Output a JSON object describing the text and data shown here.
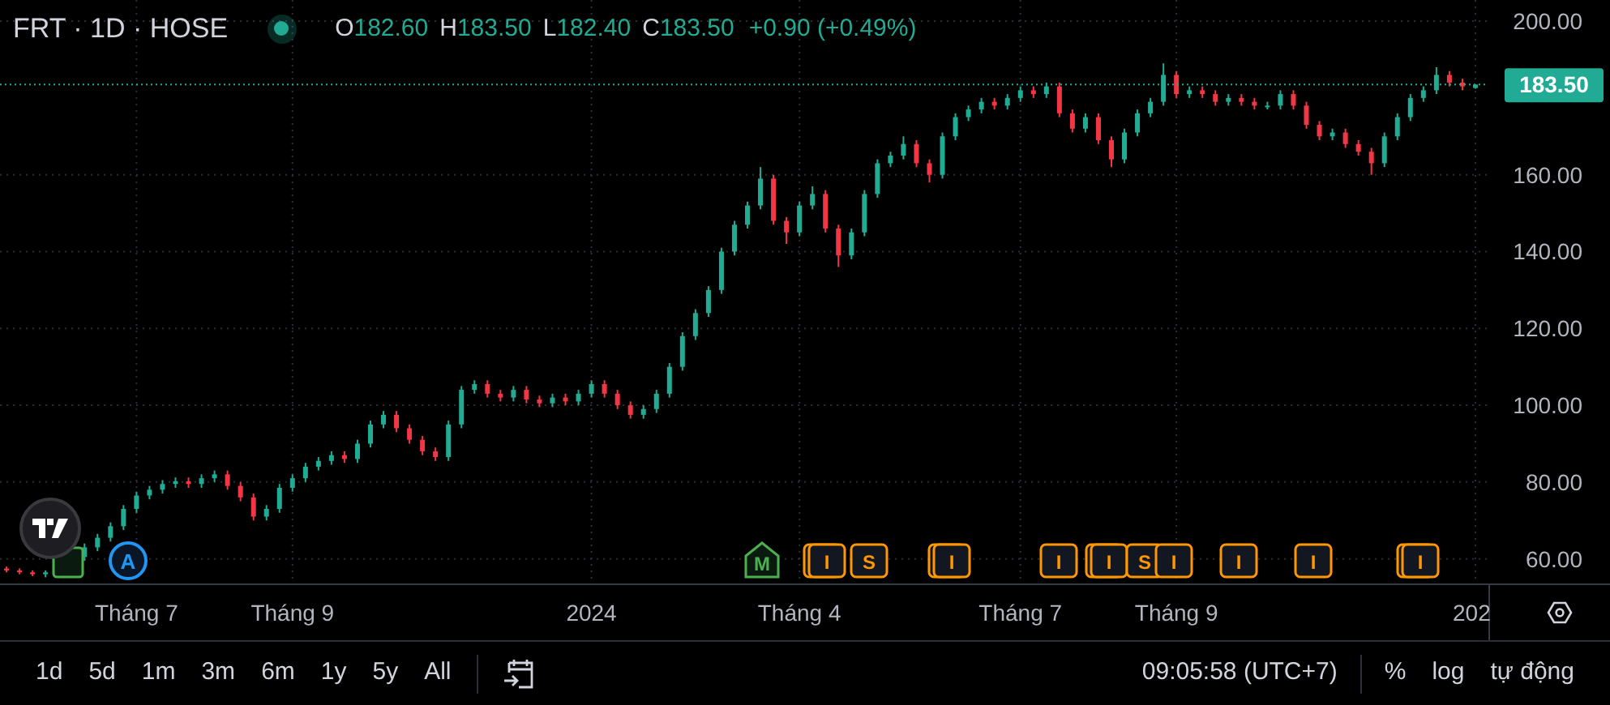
{
  "legend": {
    "symbol": "FRT · 1D · HOSE",
    "market_open": true,
    "ohlc": [
      {
        "key": "O",
        "value": "182.60"
      },
      {
        "key": "H",
        "value": "183.50"
      },
      {
        "key": "L",
        "value": "182.40"
      },
      {
        "key": "C",
        "value": "183.50"
      }
    ],
    "change": "+0.90 (+0.49%)"
  },
  "chart_data": {
    "type": "candlestick",
    "grid": true,
    "ylim": [
      53.6,
      205.5
    ],
    "yticks": [
      {
        "value": 60,
        "label": "60.00"
      },
      {
        "value": 80,
        "label": "80.00"
      },
      {
        "value": 100,
        "label": "100.00"
      },
      {
        "value": 120,
        "label": "120.00"
      },
      {
        "value": 140,
        "label": "140.00"
      },
      {
        "value": 160,
        "label": "160.00"
      },
      {
        "value": 200,
        "label": "200.00"
      }
    ],
    "categories": [
      null,
      null,
      null,
      null,
      null,
      null,
      null,
      null,
      null,
      null,
      "Tháng 7",
      null,
      null,
      null,
      null,
      null,
      null,
      null,
      null,
      null,
      null,
      null,
      "Tháng 9",
      null,
      null,
      null,
      null,
      null,
      null,
      null,
      null,
      null,
      null,
      null,
      null,
      null,
      null,
      null,
      null,
      null,
      null,
      null,
      null,
      null,
      null,
      "2024",
      null,
      null,
      null,
      null,
      null,
      null,
      null,
      null,
      null,
      null,
      null,
      null,
      null,
      null,
      null,
      "Tháng 4",
      null,
      null,
      null,
      null,
      null,
      null,
      null,
      null,
      null,
      null,
      null,
      null,
      null,
      null,
      null,
      null,
      "Tháng 7",
      null,
      null,
      null,
      null,
      null,
      null,
      null,
      null,
      null,
      null,
      null,
      "Tháng 9",
      null,
      null,
      null,
      null,
      null,
      null,
      null,
      null,
      null,
      null,
      null,
      null,
      null,
      null,
      null,
      null,
      null,
      null,
      null,
      null,
      null,
      null,
      "202"
    ],
    "ohlc": [
      [
        57.5,
        58,
        56.5,
        57
      ],
      [
        57,
        57.5,
        56,
        56.5
      ],
      [
        56.5,
        57,
        55.5,
        56
      ],
      [
        56,
        57,
        55.2,
        56.5
      ],
      null,
      null,
      [
        60.5,
        64,
        59.5,
        63
      ],
      [
        63,
        66.5,
        62,
        65.5
      ],
      [
        65.5,
        69.5,
        64.5,
        68.5
      ],
      [
        68.5,
        74,
        67.5,
        73
      ],
      [
        73,
        77.5,
        72,
        76.5
      ],
      [
        76.5,
        79,
        75.5,
        78
      ],
      [
        78,
        80.5,
        77,
        79.5
      ],
      [
        79.5,
        81.2,
        78.5,
        80.2
      ],
      [
        80.2,
        81.2,
        78.5,
        79.5
      ],
      [
        79.5,
        82,
        78.5,
        81
      ],
      [
        81,
        83,
        80,
        82
      ],
      [
        82,
        83,
        78,
        79
      ],
      [
        79,
        80,
        75,
        76
      ],
      [
        76,
        77,
        70,
        71
      ],
      [
        71,
        74,
        70,
        73
      ],
      [
        73,
        79.5,
        72,
        78.5
      ],
      [
        78.5,
        82,
        77.5,
        81
      ],
      [
        81,
        85,
        80,
        84
      ],
      [
        84,
        86.5,
        83,
        85.5
      ],
      [
        85.5,
        88,
        84.5,
        87
      ],
      [
        87,
        88,
        85,
        86
      ],
      [
        86,
        91,
        85,
        90
      ],
      [
        90,
        96,
        89,
        95
      ],
      [
        95,
        98.5,
        94,
        97.5
      ],
      [
        97.5,
        98.5,
        93,
        94
      ],
      [
        94,
        95,
        90,
        91
      ],
      [
        91,
        92,
        87,
        88
      ],
      [
        88,
        89,
        85.5,
        86.5
      ],
      [
        86.5,
        96,
        85.5,
        95
      ],
      [
        95,
        105,
        94,
        104
      ],
      [
        104,
        106.5,
        103,
        105.5
      ],
      [
        105.5,
        106.5,
        102,
        103
      ],
      [
        103,
        104,
        101,
        102
      ],
      [
        102,
        105,
        101,
        104
      ],
      [
        104,
        105,
        100.5,
        101.5
      ],
      [
        101.5,
        102.5,
        99.5,
        100.5
      ],
      [
        100.5,
        103,
        99.5,
        102
      ],
      [
        102,
        103,
        100,
        101
      ],
      [
        101,
        104,
        100,
        103
      ],
      [
        103,
        106.5,
        102,
        105.5
      ],
      [
        105.5,
        106.5,
        102,
        103
      ],
      [
        103,
        104,
        99,
        100
      ],
      [
        100,
        101,
        96.5,
        97.5
      ],
      [
        97.5,
        100,
        96.5,
        99
      ],
      [
        99,
        104,
        98,
        103
      ],
      [
        103,
        111,
        102,
        110
      ],
      [
        110,
        119,
        109,
        118
      ],
      [
        118,
        125,
        117,
        124
      ],
      [
        124,
        131,
        123,
        130
      ],
      [
        130,
        141,
        129,
        140
      ],
      [
        140,
        148,
        139,
        147
      ],
      [
        147,
        153,
        146,
        152
      ],
      [
        152,
        162,
        151,
        159
      ],
      [
        159,
        160,
        147,
        148
      ],
      [
        148,
        149,
        142,
        145
      ],
      [
        145,
        153,
        144,
        152
      ],
      [
        152,
        157,
        151,
        155
      ],
      [
        155,
        156,
        145,
        146
      ],
      [
        146,
        147,
        136,
        139
      ],
      [
        139,
        146,
        138,
        145
      ],
      [
        145,
        156,
        144,
        155
      ],
      [
        155,
        164,
        154,
        163
      ],
      [
        163,
        166,
        162,
        165
      ],
      [
        165,
        170,
        164,
        168
      ],
      [
        168,
        169,
        162,
        163
      ],
      [
        163,
        164,
        158,
        160
      ],
      [
        160,
        171,
        159,
        170
      ],
      [
        170,
        176,
        169,
        175
      ],
      [
        175,
        178,
        174,
        177
      ],
      [
        177,
        180,
        176,
        179
      ],
      [
        179,
        180,
        177,
        178
      ],
      [
        178,
        181,
        177,
        180
      ],
      [
        180,
        183,
        179,
        182
      ],
      [
        182,
        183,
        180,
        181
      ],
      [
        181,
        184,
        180,
        183
      ],
      [
        183,
        184,
        175,
        176
      ],
      [
        176,
        177,
        171,
        172
      ],
      [
        172,
        176,
        171,
        175
      ],
      [
        175,
        176,
        168,
        169
      ],
      [
        169,
        170,
        162,
        164
      ],
      [
        164,
        172,
        163,
        171
      ],
      [
        171,
        177,
        170,
        176
      ],
      [
        176,
        180,
        175,
        179
      ],
      [
        179,
        189,
        178,
        186
      ],
      [
        186,
        187,
        180,
        181
      ],
      [
        181,
        183,
        180,
        182
      ],
      [
        182,
        183,
        180,
        181
      ],
      [
        181,
        182,
        178,
        179
      ],
      [
        179,
        181,
        178,
        180
      ],
      [
        180,
        181,
        178,
        179
      ],
      [
        179,
        180,
        177,
        178
      ],
      [
        178,
        179,
        177,
        178
      ],
      [
        178,
        182,
        177,
        181
      ],
      [
        181,
        182,
        177,
        178
      ],
      [
        178,
        179,
        172,
        173
      ],
      [
        173,
        174,
        169,
        170
      ],
      [
        170,
        172,
        169,
        171
      ],
      [
        171,
        172,
        167,
        168
      ],
      [
        168,
        169,
        165,
        166
      ],
      [
        166,
        167,
        160,
        163
      ],
      [
        163,
        171,
        162,
        170
      ],
      [
        170,
        176,
        169,
        175
      ],
      [
        175,
        181,
        174,
        180
      ],
      [
        180,
        183,
        179,
        182
      ],
      [
        182,
        188,
        181,
        186
      ],
      [
        186,
        187,
        183,
        184
      ],
      [
        184,
        185,
        182,
        183
      ],
      [
        182.6,
        183.5,
        182.4,
        183.5
      ]
    ],
    "ref_lines": [
      {
        "axis": "y",
        "value": 183.5,
        "label": "183.50",
        "color": "#22ab94"
      }
    ]
  },
  "event_markers": [
    {
      "kind": "square"
    },
    {
      "kind": "circle",
      "label": "A"
    },
    {
      "kind": "pentagon",
      "label": "M"
    },
    {
      "kind": "box",
      "label": "I",
      "stacked": true
    },
    {
      "kind": "box",
      "label": "S",
      "stacked": false
    },
    {
      "kind": "box",
      "label": "I",
      "stacked": true
    },
    {
      "kind": "box",
      "label": "I",
      "stacked": false
    },
    {
      "kind": "box",
      "label": "I",
      "stacked": true
    },
    {
      "kind": "box",
      "label": "S",
      "stacked": false
    },
    {
      "kind": "box",
      "label": "I",
      "stacked": false
    },
    {
      "kind": "box",
      "label": "I",
      "stacked": false
    },
    {
      "kind": "box",
      "label": "I",
      "stacked": false
    },
    {
      "kind": "box",
      "label": "I",
      "stacked": true
    }
  ],
  "ranges": [
    {
      "label": "1d"
    },
    {
      "label": "5d"
    },
    {
      "label": "1m"
    },
    {
      "label": "3m"
    },
    {
      "label": "6m"
    },
    {
      "label": "1y"
    },
    {
      "label": "5y"
    },
    {
      "label": "All"
    }
  ],
  "clock": "09:05:58 (UTC+7)",
  "scale_options": [
    {
      "label": "%"
    },
    {
      "label": "log"
    },
    {
      "label": "tự động"
    }
  ]
}
